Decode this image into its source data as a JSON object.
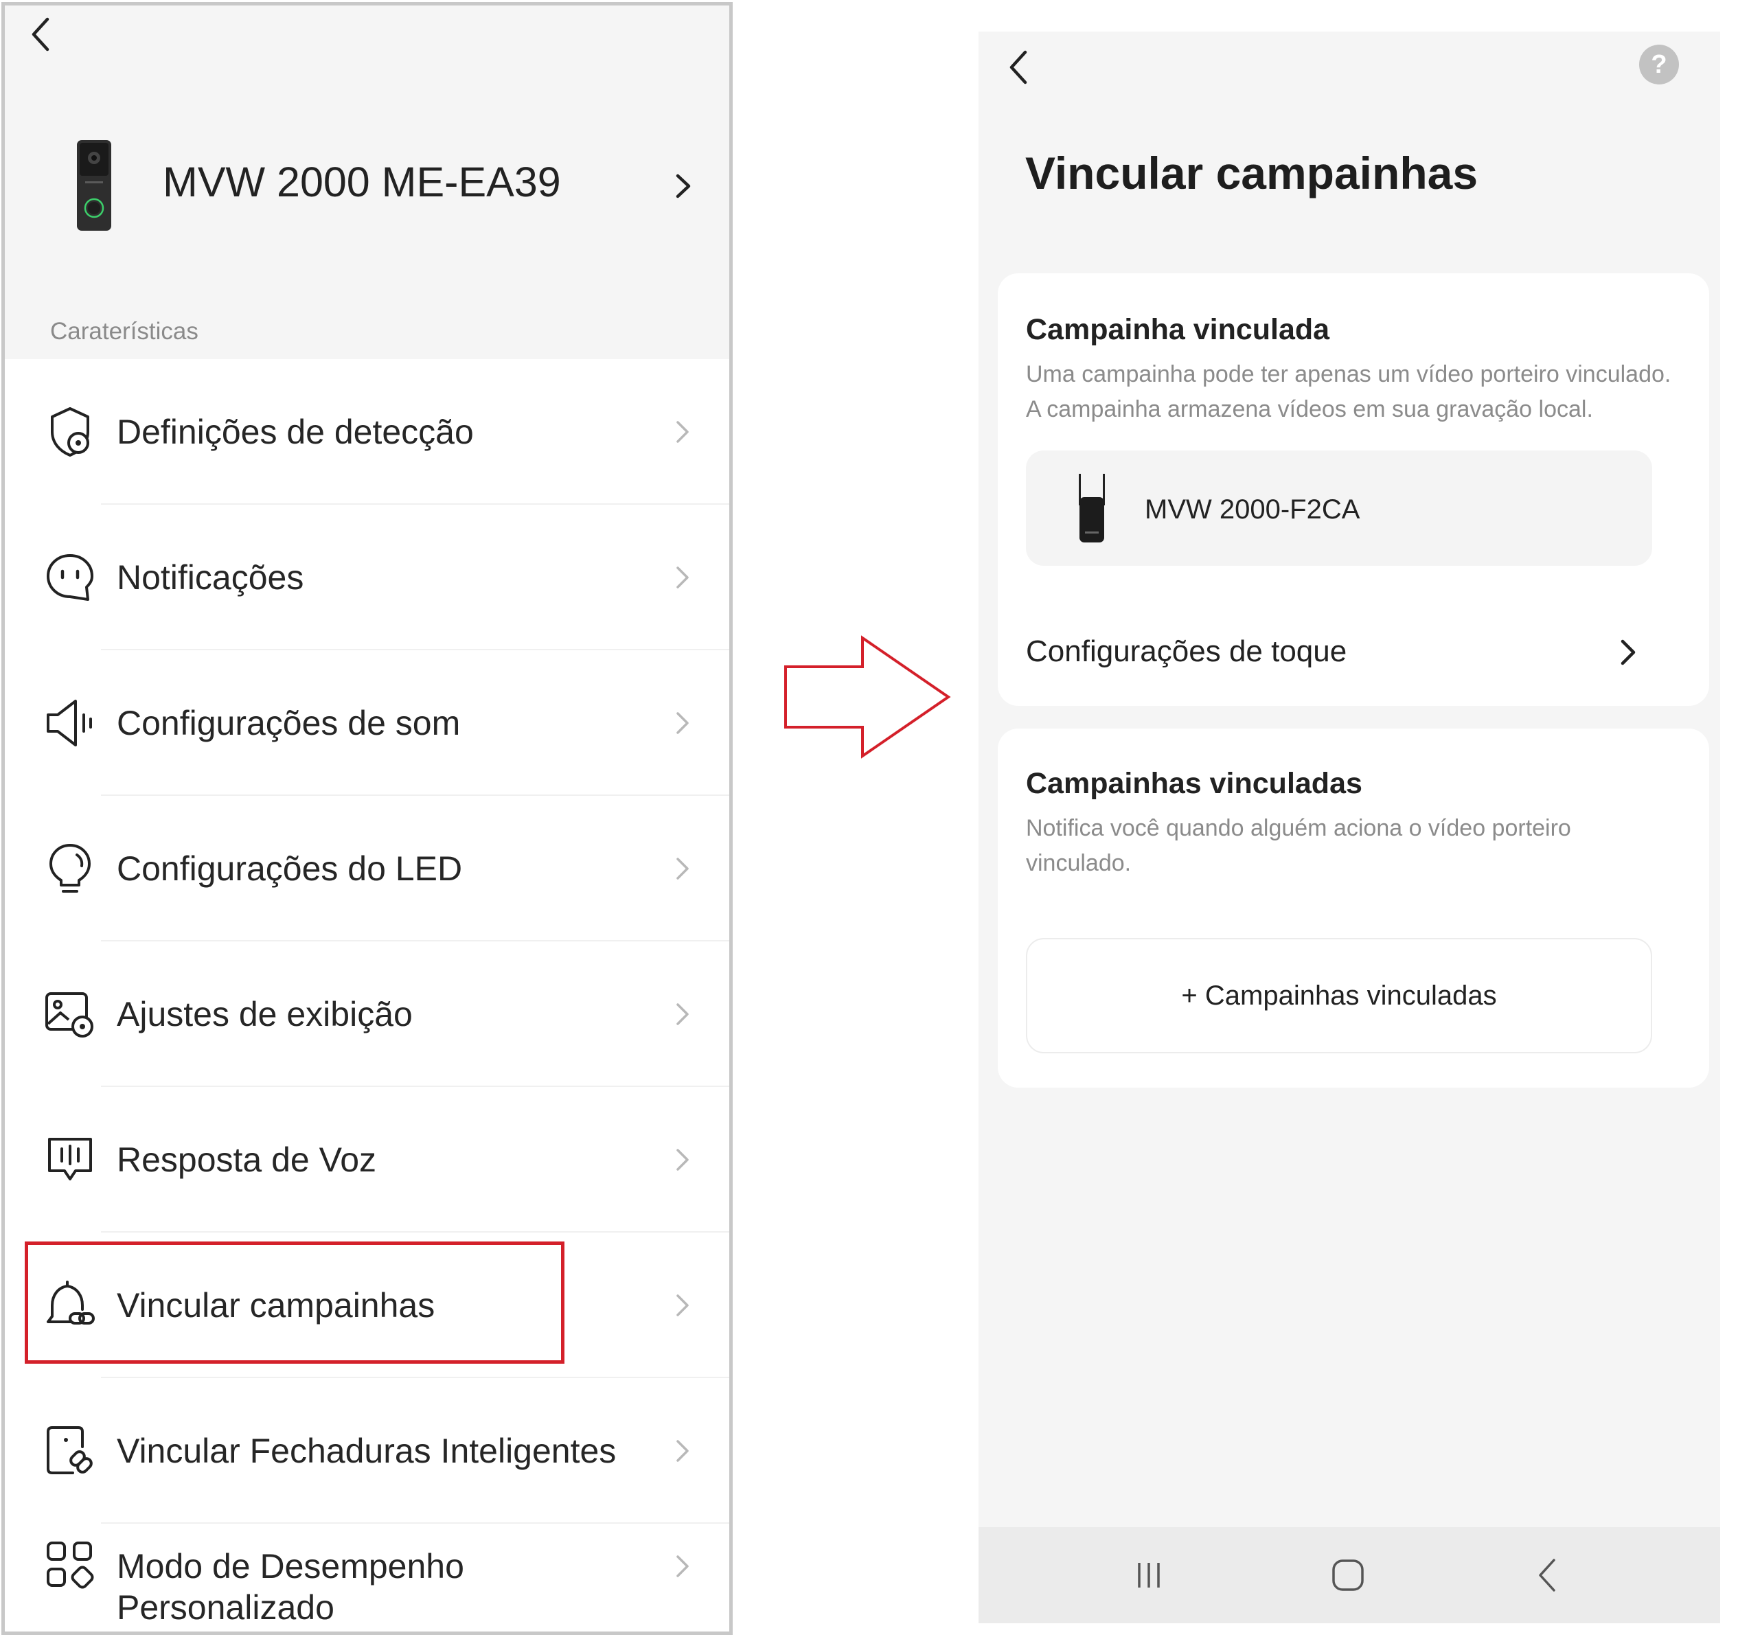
{
  "left": {
    "device": {
      "name": "MVW 2000 ME-EA39"
    },
    "section_label": "Caraterísticas",
    "menu": [
      {
        "label": "Definições de detecção",
        "icon": "shield-settings-icon"
      },
      {
        "label": "Notificações",
        "icon": "notification-bubble-icon"
      },
      {
        "label": "Configurações de som",
        "icon": "speaker-icon"
      },
      {
        "label": "Configurações do LED",
        "icon": "lightbulb-icon"
      },
      {
        "label": "Ajustes de exibição",
        "icon": "image-settings-icon"
      },
      {
        "label": "Resposta de Voz",
        "icon": "voice-response-icon"
      },
      {
        "label": "Vincular campainhas",
        "icon": "bell-link-icon",
        "highlighted": true
      },
      {
        "label": "Vincular Fechaduras Inteligentes",
        "icon": "lock-link-icon"
      },
      {
        "label": "Modo de Desempenho Personalizado",
        "icon": "performance-grid-icon"
      }
    ]
  },
  "right": {
    "title": "Vincular campainhas",
    "linked_card": {
      "title": "Campainha vinculada",
      "description": "Uma campainha pode ter apenas um vídeo porteiro vinculado. A campainha armazena vídeos em sua gravação local.",
      "chime_name": "MVW 2000-F2CA",
      "ring_settings_label": "Configurações de toque"
    },
    "linked_multi_card": {
      "title": "Campainhas vinculadas",
      "description": "Notifica você quando alguém aciona o vídeo porteiro vinculado.",
      "add_button_label": "+ Campainhas vinculadas"
    }
  },
  "colors": {
    "highlight": "#d4202a",
    "page_bg": "#f5f5f5",
    "card_bg": "#ffffff",
    "help_icon_bg": "#c2c2c2"
  }
}
